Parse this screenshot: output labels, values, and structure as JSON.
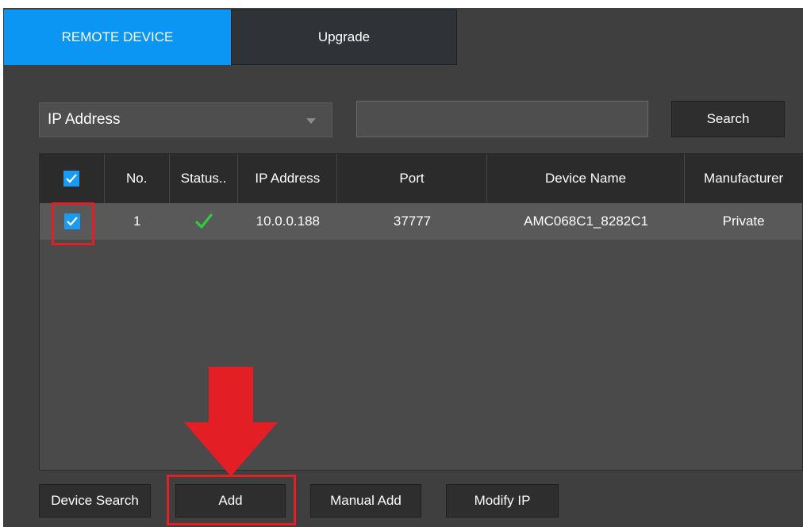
{
  "tabs": {
    "remote_device": "REMOTE DEVICE",
    "upgrade": "Upgrade"
  },
  "filter": {
    "selected": "IP Address",
    "search_value": "",
    "search_label": "Search"
  },
  "table": {
    "headers": {
      "no": "No.",
      "status": "Status..",
      "ip": "IP Address",
      "port": "Port",
      "device_name": "Device Name",
      "manufacturer": "Manufacturer"
    },
    "rows": [
      {
        "no": "1",
        "status_icon": "check-icon",
        "ip": "10.0.0.188",
        "port": "37777",
        "device_name": "AMC068C1_8282C1",
        "manufacturer": "Private"
      }
    ]
  },
  "buttons": {
    "device_search": "Device Search",
    "add": "Add",
    "manual_add": "Manual Add",
    "modify_ip": "Modify IP"
  },
  "colors": {
    "accent": "#0b96f3",
    "checkbox": "#1a9bf3",
    "status_ok": "#2ecc40",
    "highlight": "#e31e24"
  }
}
